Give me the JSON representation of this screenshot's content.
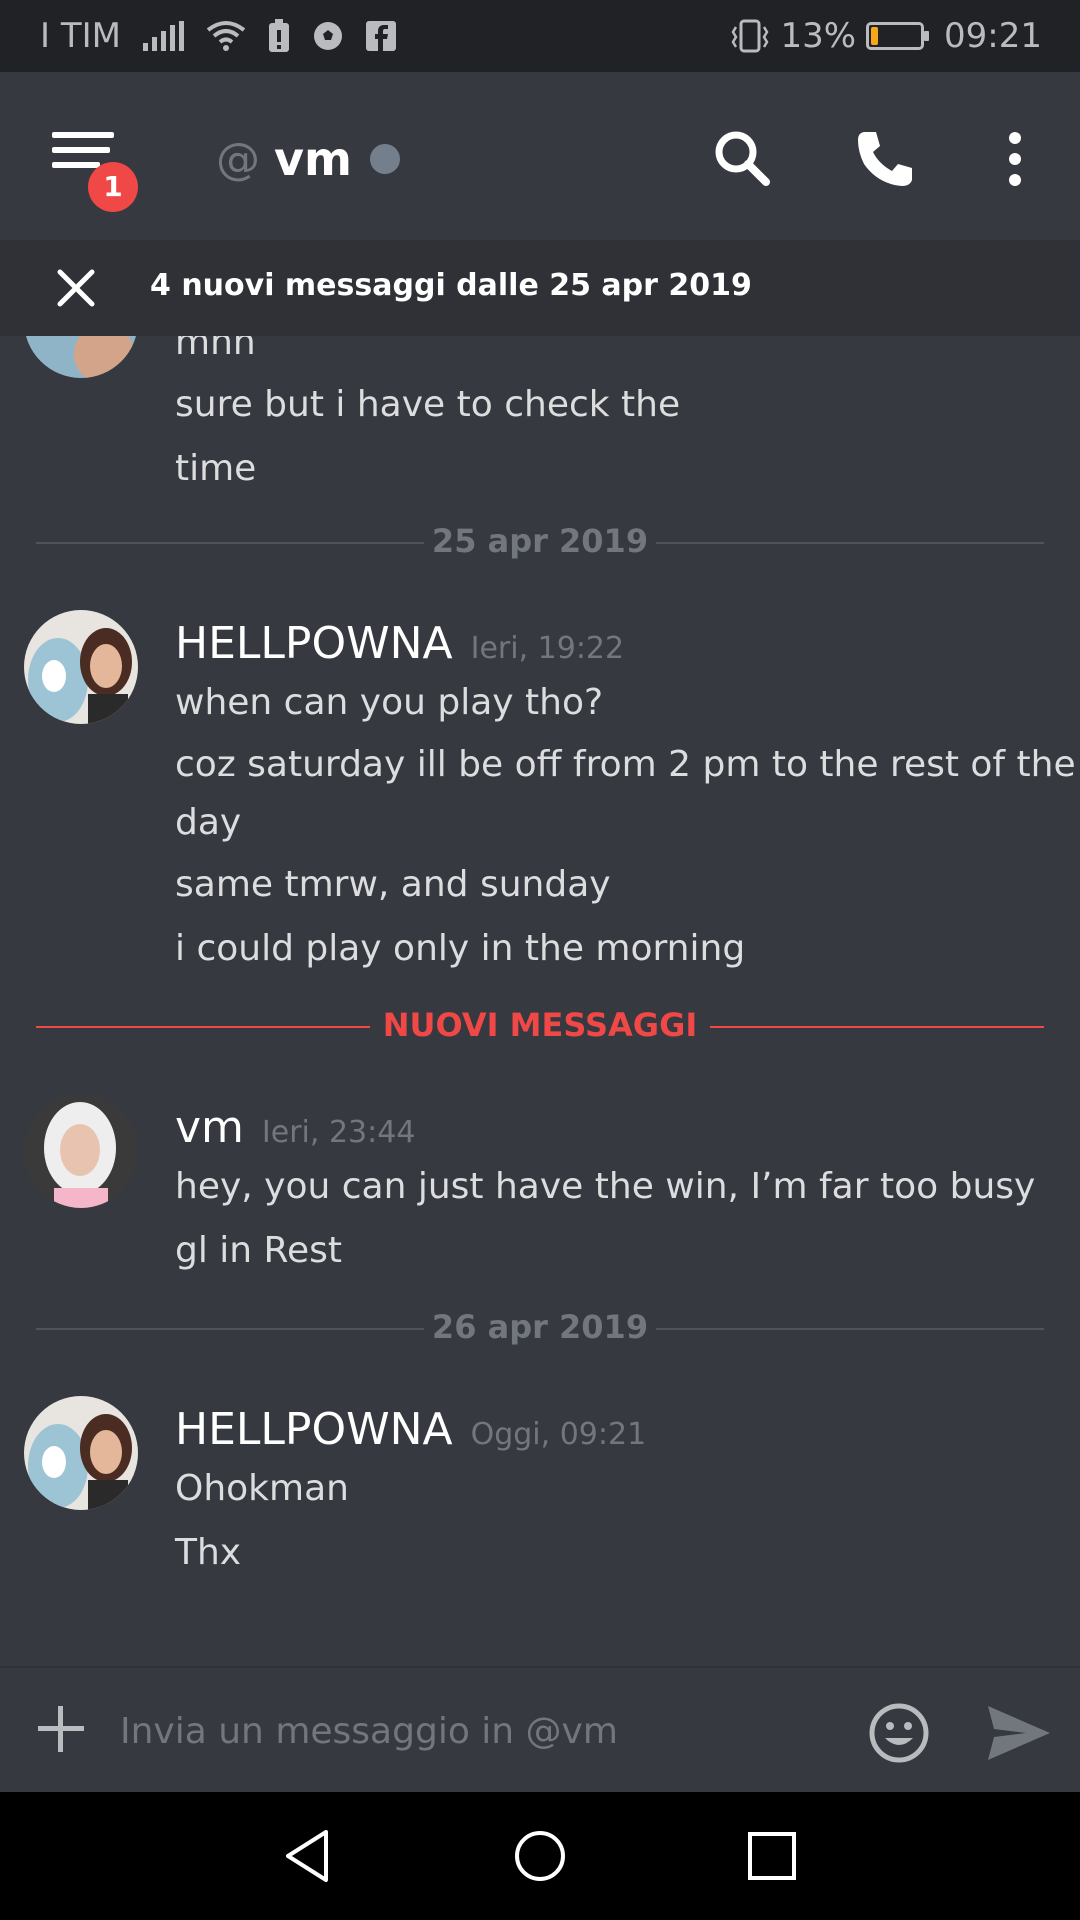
{
  "status_bar": {
    "carrier": "I TIM",
    "battery_percent": "13%",
    "battery_level": 0.13,
    "time": "09:21",
    "icons": [
      "signal-icon",
      "wifi-icon",
      "battery-saver-icon",
      "soccer-ball-icon",
      "facebook-icon",
      "vibrate-icon",
      "battery-icon"
    ]
  },
  "header": {
    "at_symbol": "@",
    "channel_name": "vm",
    "notification_count": "1",
    "icons": [
      "menu-icon",
      "search-icon",
      "phone-icon",
      "more-icon"
    ]
  },
  "new_messages_bar": {
    "text": "4 nuovi messaggi dalle 25 apr 2019"
  },
  "messages": {
    "partial_lines": [
      "mnn",
      "sure but i have to check the",
      "time"
    ],
    "divider_1": "25 apr 2019",
    "group_1": {
      "author": "HELLPOWNA",
      "timestamp": "Ieri, 19:22",
      "lines": [
        "when can you play tho?",
        "coz saturday ill be off from 2 pm to the rest of the",
        "day",
        "same tmrw, and sunday",
        "i could play only in the morning"
      ]
    },
    "new_divider": "NUOVI MESSAGGI",
    "group_2": {
      "author": "vm",
      "timestamp": "Ieri, 23:44",
      "lines": [
        "hey, you can just have the win, I’m far too busy",
        "gl in Rest"
      ]
    },
    "divider_2": "26 apr 2019",
    "group_3": {
      "author": "HELLPOWNA",
      "timestamp": "Oggi, 09:21",
      "lines": [
        "Ohokman",
        "Thx"
      ]
    }
  },
  "composer": {
    "placeholder": "Invia un messaggio in @vm",
    "value": ""
  },
  "colors": {
    "background": "#36393f",
    "header_bar": "#2f3136",
    "status_bar": "#202225",
    "accent_red": "#f04747",
    "text": "#dcddde",
    "muted": "#72767d"
  }
}
